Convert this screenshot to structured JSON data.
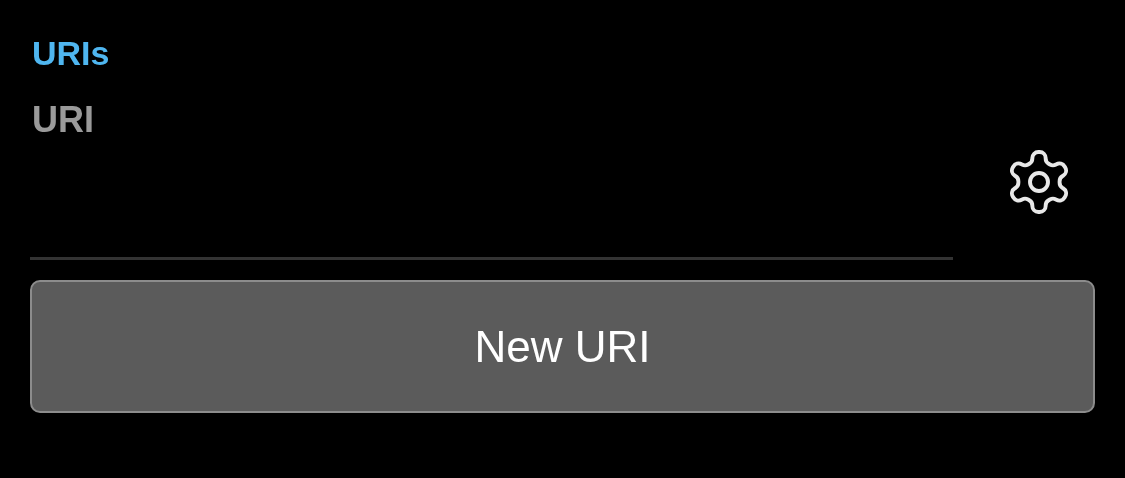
{
  "section": {
    "title": "URIs"
  },
  "uri_field": {
    "label": "URI"
  },
  "button": {
    "label": "New URI"
  }
}
